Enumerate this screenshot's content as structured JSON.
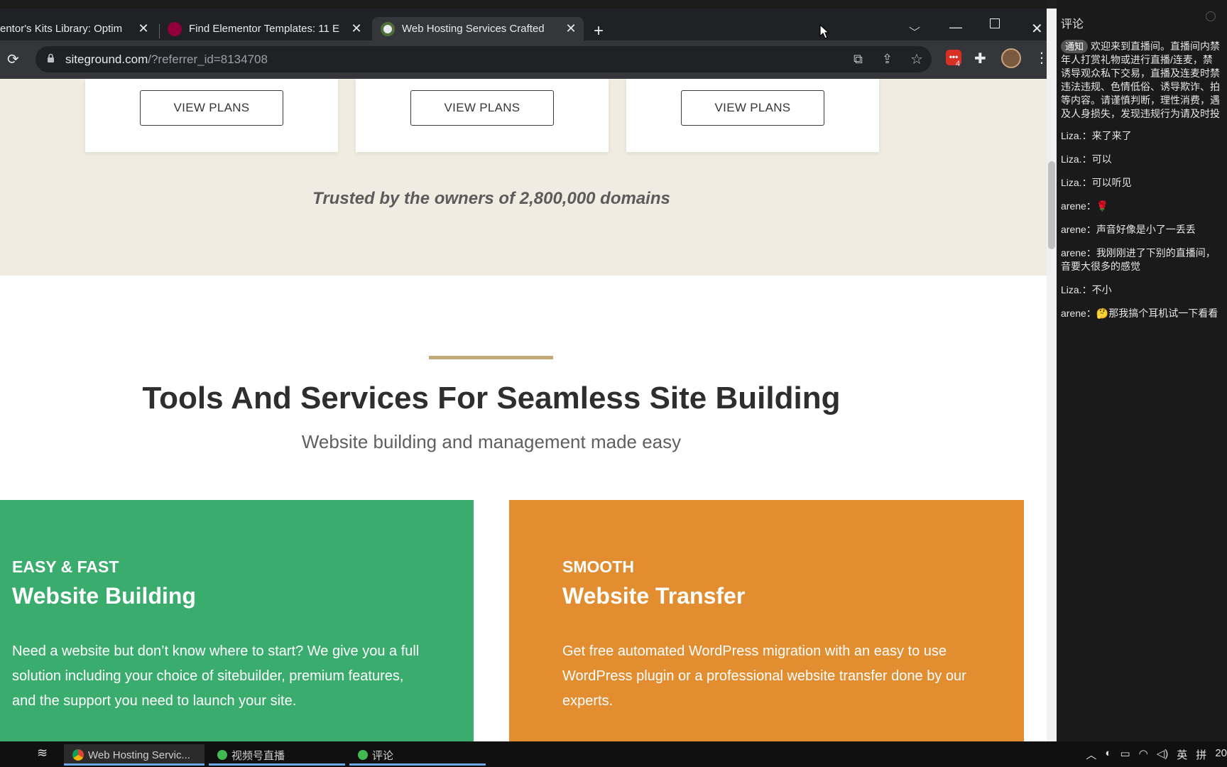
{
  "browser": {
    "tabs": [
      {
        "label": "entor's Kits Library: Optim",
        "active": false
      },
      {
        "label": "Find Elementor Templates: 11 E",
        "active": false
      },
      {
        "label": "Web Hosting Services Crafted",
        "active": true
      }
    ],
    "url_host": "siteground.com",
    "url_path": "/?referrer_id=8134708",
    "extension_badge": "4",
    "new_tab_label": "+"
  },
  "page": {
    "plan_button_label": "VIEW PLANS",
    "trusted_text": "Trusted by the owners of 2,800,000 domains",
    "section_title": "Tools And Services For Seamless Site Building",
    "section_subtitle": "Website building and management made easy",
    "features": [
      {
        "kicker": "EASY & FAST",
        "title": "Website Building",
        "description": "Need a website but don’t know where to start? We give you a full solution including your choice of sitebuilder, premium features, and the support you need to launch your site.",
        "color": "#3aac6e"
      },
      {
        "kicker": "SMOOTH",
        "title": "Website Transfer",
        "description": "Get free automated WordPress migration with an easy to use WordPress plugin or a professional website transfer done by our experts.",
        "color": "#e28d30"
      }
    ],
    "accent_color": "#c2a978"
  },
  "comments": {
    "title": "评论",
    "notice_badge": "通知",
    "notice_lines": [
      "欢迎来到直播间。直播间内禁",
      "年人打赏礼物或进行直播/连麦，禁",
      "诱导观众私下交易，直播及连麦时禁",
      "违法违规、色情低俗、诱导欺诈、拍",
      "等内容。请谨慎判断，理性消费，遇",
      "及人身损失，发现违规行为请及时投"
    ],
    "items": [
      {
        "author": "Liza.：",
        "text": "来了来了"
      },
      {
        "author": "Liza.：",
        "text": "可以"
      },
      {
        "author": "Liza.：",
        "text": "可以听见"
      },
      {
        "author": "arene：",
        "text": "🌹"
      },
      {
        "author": "arene：",
        "text": "声音好像是小了一丢丢"
      },
      {
        "author": "arene：",
        "text": "我刚刚进了下别的直播间，",
        "text2": "音要大很多的感觉"
      },
      {
        "author": "Liza.：",
        "text": "不小"
      },
      {
        "author": "arene：",
        "text": "🤔那我搞个耳机试一下看看"
      }
    ]
  },
  "taskbar": {
    "items": [
      {
        "label": "Web Hosting Servic..."
      },
      {
        "label": "视频号直播"
      },
      {
        "label": "评论"
      }
    ],
    "ime_lang": "英",
    "ime_mode": "拼",
    "clock_partial": "20"
  }
}
